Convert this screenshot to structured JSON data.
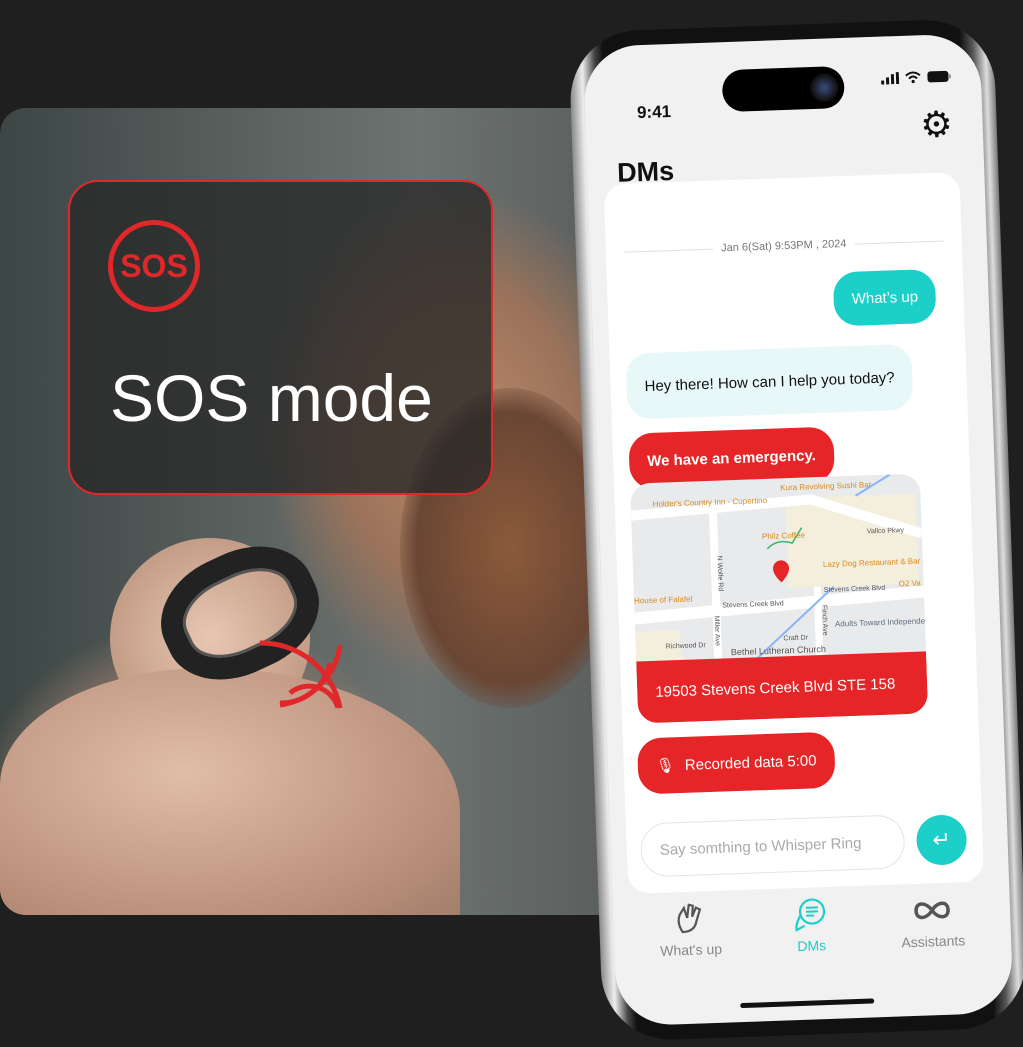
{
  "promo": {
    "sos_badge": "SOS",
    "title": "SOS mode"
  },
  "status": {
    "time": "9:41"
  },
  "header": {
    "title": "DMs",
    "settings_icon": "gear-icon"
  },
  "chat": {
    "date": "Jan 6(Sat) 9:53PM , 2024",
    "messages": [
      {
        "from": "user",
        "text": "What’s up"
      },
      {
        "from": "assistant",
        "text": "Hey there! How can I help you today?"
      },
      {
        "from": "user",
        "text": "We have an emergency.",
        "style": "alert"
      }
    ],
    "location": {
      "address": "19503 Stevens Creek Blvd STE 158",
      "map_labels": [
        "Holder's Country Inn - Cupertino",
        "Kura Revolving Sushi Bar",
        "Philz Coffee",
        "Vallco Pkwy",
        "Lazy Dog Restaurant & Bar",
        "N Wolfe Rd",
        "House of Falafel",
        "Stevens Creek Blvd",
        "Stevens Creek Blvd",
        "O2 Va",
        "Miller Ave",
        "Finch Ave",
        "Craft Dr",
        "Adults Toward Independent Living",
        "Richwood Dr",
        "Bethel Lutheran Church"
      ]
    },
    "recording": {
      "label": "Recorded data 5:00",
      "icon": "microphone-icon"
    },
    "input_placeholder": "Say somthing to Whisper Ring"
  },
  "colors": {
    "accent": "#1ccfc8",
    "alert": "#e52527"
  },
  "tabs": [
    {
      "label": "What's up",
      "icon": "wave-hand-icon",
      "active": false
    },
    {
      "label": "DMs",
      "icon": "chat-bubbles-icon",
      "active": true
    },
    {
      "label": "Assistants",
      "icon": "infinity-icon",
      "active": false
    }
  ]
}
